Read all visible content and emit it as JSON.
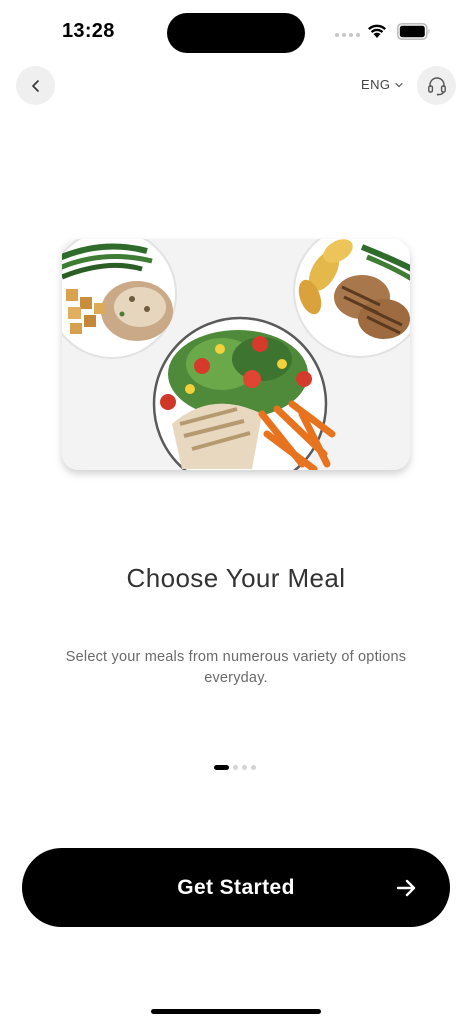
{
  "status_bar": {
    "time": "13:28"
  },
  "nav": {
    "language": "ENG",
    "icons": {
      "back": "chevron-left-icon",
      "language_toggle": "chevron-down-icon",
      "support": "headset-icon"
    }
  },
  "hero": {
    "image": "meal-plates-photo"
  },
  "onboarding": {
    "title": "Choose Your Meal",
    "subtitle": "Select your meals from numerous variety of options everyday.",
    "page_index": 1,
    "page_count": 4
  },
  "cta": {
    "label": "Get Started",
    "icon": "arrow-right-icon"
  },
  "colors": {
    "background": "#ffffff",
    "primary": "#000000",
    "button_bg": "#efefef",
    "dot_inactive": "#d5d5d5"
  }
}
